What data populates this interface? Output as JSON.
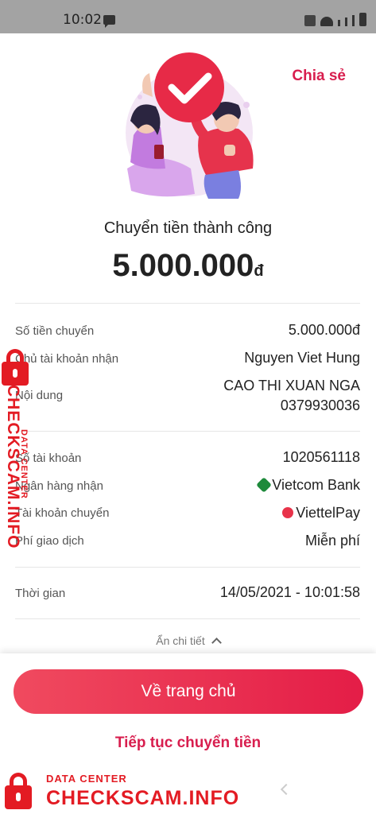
{
  "status_bar": {
    "time": "10:02"
  },
  "header": {
    "share_label": "Chia sẻ"
  },
  "result": {
    "title": "Chuyển tiền thành công",
    "amount": "5.000.000",
    "currency": "đ"
  },
  "details": {
    "amount_label": "Số tiền chuyển",
    "amount_value": "5.000.000đ",
    "recipient_label": "Chủ tài khoản nhận",
    "recipient_value": "Nguyen Viet Hung",
    "content_label": "Nội dung",
    "content_line1": "CAO THI XUAN NGA",
    "content_line2": "0379930036",
    "account_label": "Số tài khoản",
    "account_value": "1020561118",
    "bank_label": "Ngân hàng nhận",
    "bank_value": "Vietcom Bank",
    "source_label": "Tài khoản chuyển",
    "source_value": "ViettelPay",
    "fee_label": "Phí giao dịch",
    "fee_value": "Miễn phí",
    "time_label": "Thời gian",
    "time_value": "14/05/2021 - 10:01:58",
    "hide_label": "Ẩn chi tiết"
  },
  "actions": {
    "home_label": "Về trang chủ",
    "continue_label": "Tiếp tục chuyển tiền"
  },
  "watermark": {
    "small": "DATA CENTER",
    "big": "CHECKSCAM.INFO"
  },
  "colors": {
    "accent": "#d81e4e",
    "button": "#e41d47",
    "watermark": "#e31b23",
    "bank_logo": "#1e8a3b",
    "viettel_logo": "#e8334a"
  }
}
